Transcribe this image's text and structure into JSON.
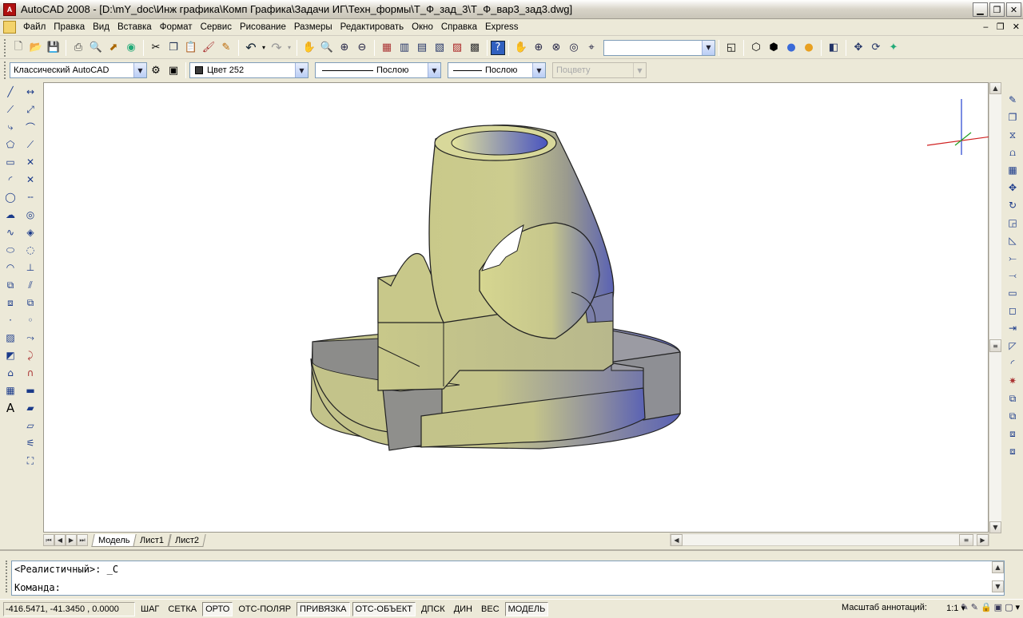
{
  "window": {
    "app_icon": "A",
    "title": "AutoCAD 2008 - [D:\\mY_doc\\Инж графика\\Комп Графика\\Задачи ИГ\\Техн_формы\\Т_Ф_зад_3\\Т_Ф_вар3_зад3.dwg]"
  },
  "menu": {
    "items": [
      "Файл",
      "Правка",
      "Вид",
      "Вставка",
      "Формат",
      "Сервис",
      "Рисование",
      "Размеры",
      "Редактировать",
      "Окно",
      "Справка",
      "Express"
    ]
  },
  "toolbar": {
    "workspace": "Классический AutoCAD",
    "color": "Цвет 252",
    "linetype": "Послою",
    "lineweight": "Послою",
    "plotstyle": "Поцвету",
    "named_view": ""
  },
  "tabs": {
    "model": "Модель",
    "layout1": "Лист1",
    "layout2": "Лист2"
  },
  "command": {
    "history": "<Реалистичный>: _C",
    "prompt": "Команда:"
  },
  "status": {
    "coords": "-416.5471, -41.3450 , 0.0000",
    "toggles": [
      {
        "label": "ШАГ",
        "on": false
      },
      {
        "label": "СЕТКА",
        "on": false
      },
      {
        "label": "ОРТО",
        "on": true
      },
      {
        "label": "ОТС-ПОЛЯР",
        "on": false
      },
      {
        "label": "ПРИВЯЗКА",
        "on": true
      },
      {
        "label": "ОТС-ОБЪЕКТ",
        "on": true
      },
      {
        "label": "ДПСК",
        "on": false
      },
      {
        "label": "ДИН",
        "on": false
      },
      {
        "label": "ВЕС",
        "on": false
      },
      {
        "label": "МОДЕЛЬ",
        "on": true
      }
    ],
    "annotation_scale_label": "Масштаб аннотаций:",
    "annotation_scale": "1:1"
  },
  "colors": {
    "model_light": "#d3d38e",
    "model_mid": "#9a9a8c",
    "model_dark": "#5a62b4",
    "ucs_x": "#d02020",
    "ucs_y": "#20a020",
    "ucs_z": "#2040d0"
  }
}
